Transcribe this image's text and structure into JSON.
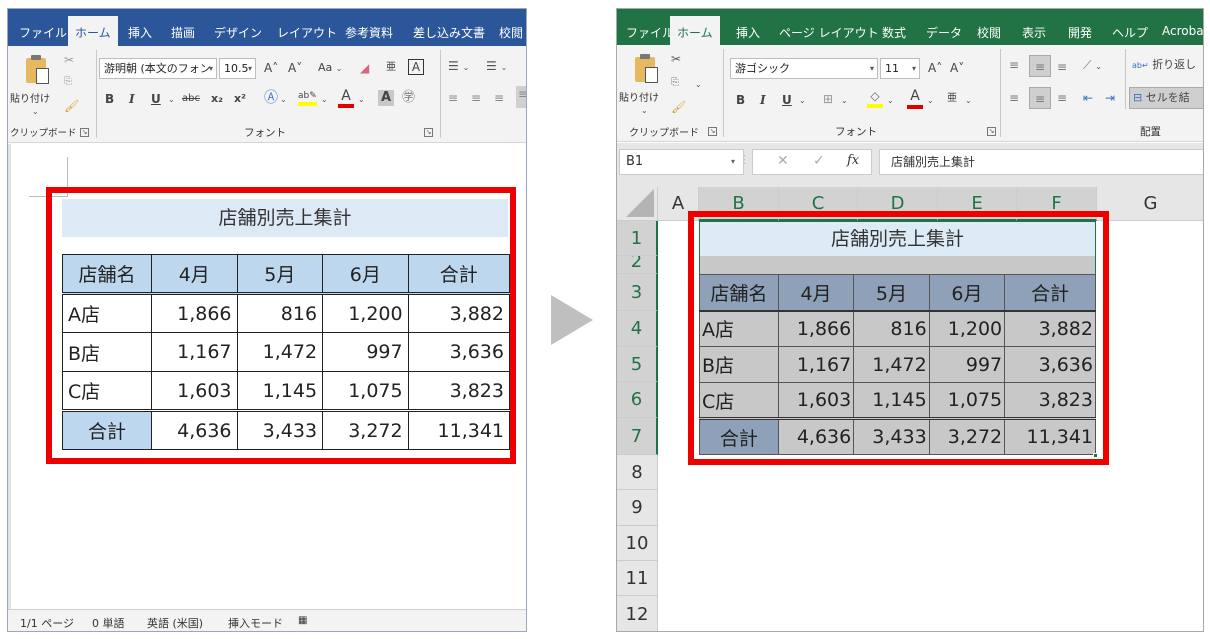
{
  "word": {
    "tabs": [
      "ファイル",
      "ホーム",
      "挿入",
      "描画",
      "デザイン",
      "レイアウト",
      "参考資料",
      "差し込み文書",
      "校閲"
    ],
    "active_tab": "ホーム",
    "ribbon": {
      "paste_label": "貼り付け",
      "clipboard_group": "クリップボード",
      "font_group": "フォント",
      "font_name": "游明朝 (本文のフォン",
      "font_size": "10.5",
      "change_case": "Aa",
      "bold": "B",
      "italic": "I",
      "underline": "U",
      "strikethrough": "abc",
      "subscript": "x₂",
      "superscript": "x²"
    },
    "document": {
      "table_title": "店舗別売上集計",
      "headers": [
        "店舗名",
        "4月",
        "5月",
        "6月",
        "合計"
      ],
      "rows": [
        [
          "A店",
          "1,866",
          "816",
          "1,200",
          "3,882"
        ],
        [
          "B店",
          "1,167",
          "1,472",
          "997",
          "3,636"
        ],
        [
          "C店",
          "1,603",
          "1,145",
          "1,075",
          "3,823"
        ]
      ],
      "total_row": [
        "合計",
        "4,636",
        "3,433",
        "3,272",
        "11,341"
      ]
    },
    "status_bar": {
      "page": "1/1 ページ",
      "words": "0 単語",
      "language": "英語 (米国)",
      "mode": "挿入モード"
    }
  },
  "excel": {
    "tabs": [
      "ファイル",
      "ホーム",
      "挿入",
      "ページ レイアウト",
      "数式",
      "データ",
      "校閲",
      "表示",
      "開発",
      "ヘルプ",
      "Acroba"
    ],
    "active_tab": "ホーム",
    "ribbon": {
      "paste_label": "貼り付け",
      "clipboard_group": "クリップボード",
      "font_group": "フォント",
      "alignment_group": "配置",
      "font_name": "游ゴシック",
      "font_size": "11",
      "wrap_text": "折り返し",
      "merge_cells": "セルを結",
      "bold": "B",
      "italic": "I",
      "underline": "U"
    },
    "formula_bar": {
      "name_box": "B1",
      "fx": "fx",
      "content": "店舗別売上集計"
    },
    "columns": [
      "A",
      "B",
      "C",
      "D",
      "E",
      "F",
      "G"
    ],
    "rows": [
      "1",
      "2",
      "3",
      "4",
      "5",
      "6",
      "7",
      "8",
      "9",
      "10",
      "11",
      "12"
    ],
    "sheet": {
      "table_title": "店舗別売上集計",
      "headers": [
        "店舗名",
        "4月",
        "5月",
        "6月",
        "合計"
      ],
      "rows": [
        [
          "A店",
          "1,866",
          "816",
          "1,200",
          "3,882"
        ],
        [
          "B店",
          "1,167",
          "1,472",
          "997",
          "3,636"
        ],
        [
          "C店",
          "1,603",
          "1,145",
          "1,075",
          "3,823"
        ]
      ],
      "total_row": [
        "合計",
        "4,636",
        "3,433",
        "3,272",
        "11,341"
      ]
    }
  },
  "colors": {
    "word_brand": "#2b579a",
    "excel_brand": "#217346",
    "highlight": "#ee0000"
  }
}
